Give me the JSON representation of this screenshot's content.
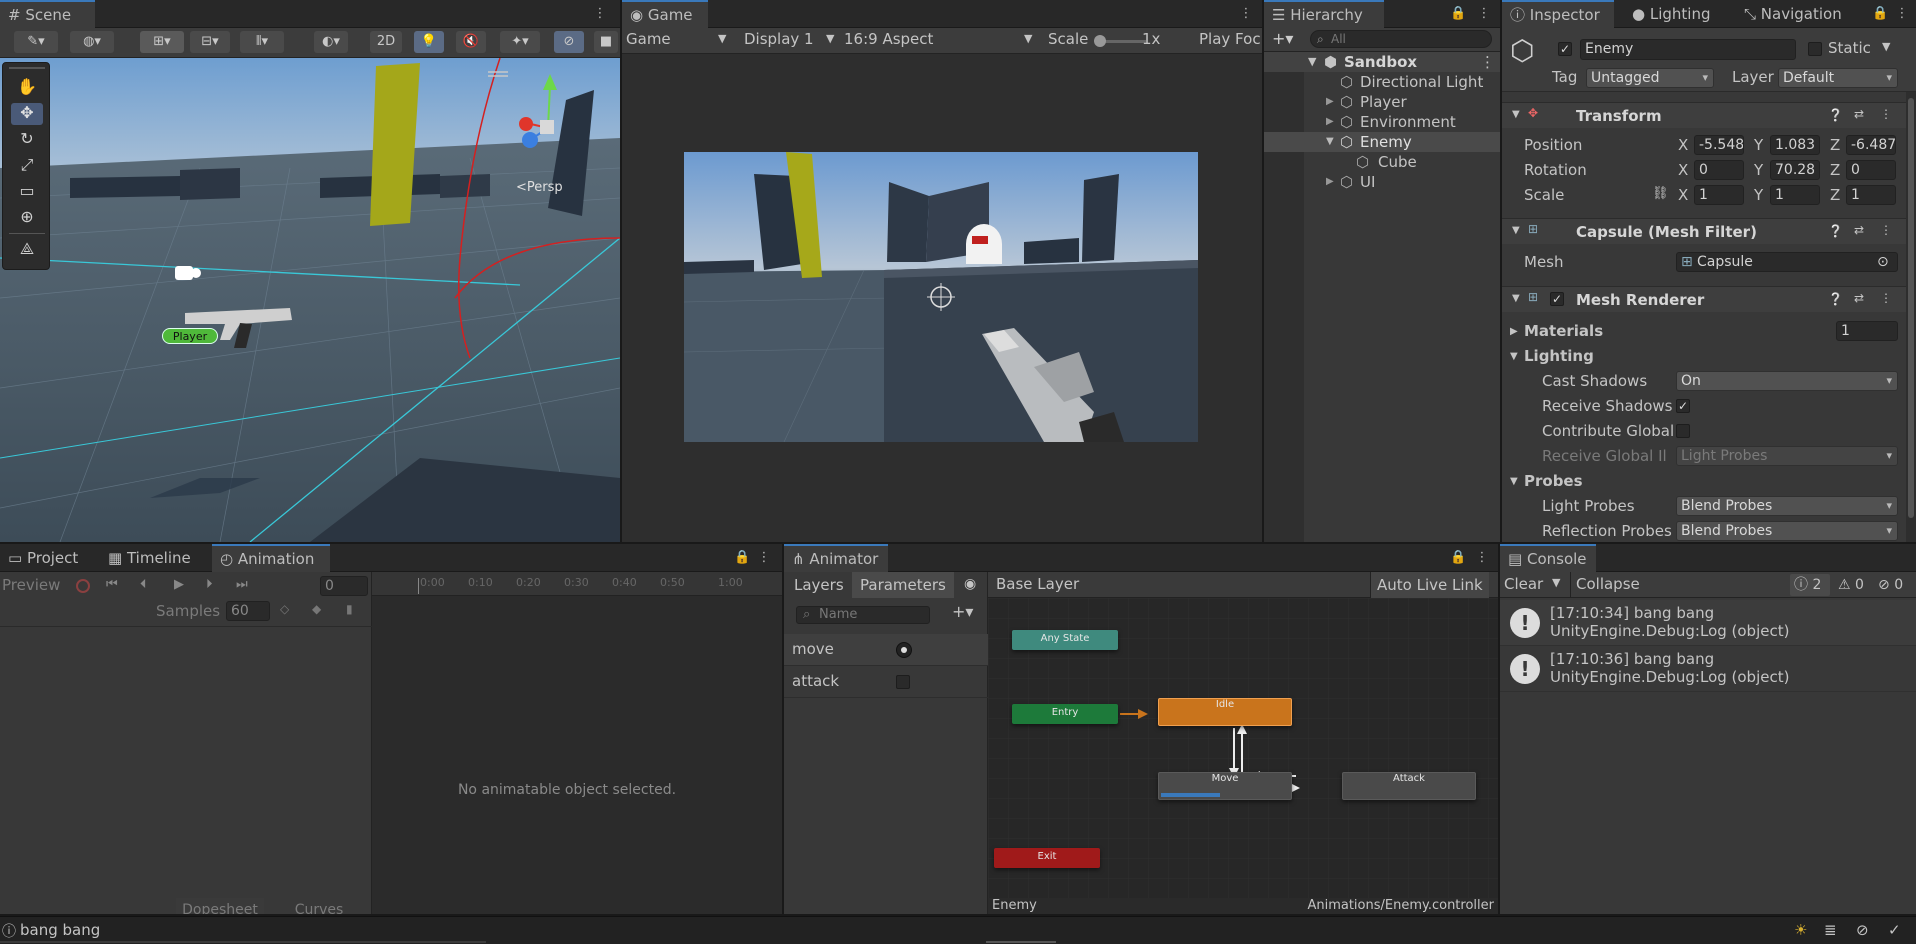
{
  "scene": {
    "tab": "Scene",
    "mode_2d": "2D",
    "persp": "Persp",
    "player_label": "Player"
  },
  "game": {
    "tab": "Game",
    "view": "Game",
    "display": "Display 1",
    "aspect": "16:9 Aspect",
    "scale_label": "Scale",
    "scale_value": "1x",
    "play_focused": "Play Foc"
  },
  "hierarchy": {
    "tab": "Hierarchy",
    "search_placeholder": "All",
    "scene_name": "Sandbox",
    "items": [
      "Directional Light",
      "Player",
      "Environment",
      "Enemy",
      "Cube",
      "UI"
    ]
  },
  "inspector": {
    "tabs": [
      "Inspector",
      "Lighting",
      "Navigation"
    ],
    "object_name": "Enemy",
    "static_label": "Static",
    "tag_label": "Tag",
    "tag_value": "Untagged",
    "layer_label": "Layer",
    "layer_value": "Default",
    "transform": {
      "title": "Transform",
      "position_label": "Position",
      "rotation_label": "Rotation",
      "scale_label": "Scale",
      "position": {
        "x": "-5.548",
        "y": "1.083",
        "z": "-6.487"
      },
      "rotation": {
        "x": "0",
        "y": "70.28",
        "z": "0"
      },
      "scale": {
        "x": "1",
        "y": "1",
        "z": "1"
      },
      "axis_x": "X",
      "axis_y": "Y",
      "axis_z": "Z"
    },
    "mesh_filter": {
      "title": "Capsule (Mesh Filter)",
      "mesh_label": "Mesh",
      "mesh_value": "Capsule"
    },
    "mesh_renderer": {
      "title": "Mesh Renderer",
      "materials_label": "Materials",
      "materials_count": "1",
      "lighting_label": "Lighting",
      "cast_shadows_label": "Cast Shadows",
      "cast_shadows_value": "On",
      "receive_shadows_label": "Receive Shadows",
      "contribute_gi_label": "Contribute Global",
      "receive_gi_label": "Receive Global Illu",
      "receive_gi_value": "Light Probes",
      "probes_label": "Probes",
      "light_probes_label": "Light Probes",
      "light_probes_value": "Blend Probes",
      "reflection_probes_label": "Reflection Probes",
      "reflection_probes_value": "Blend Probes"
    }
  },
  "animation": {
    "tabs": [
      "Project",
      "Timeline",
      "Animation"
    ],
    "preview": "Preview",
    "frame": "0",
    "samples_label": "Samples",
    "samples_value": "60",
    "ticks": [
      "0:00",
      "0:10",
      "0:20",
      "0:30",
      "0:40",
      "0:50",
      "1:00"
    ],
    "empty_message": "No animatable object selected.",
    "dopesheet": "Dopesheet",
    "curves": "Curves"
  },
  "animator": {
    "tab": "Animator",
    "layers_tab": "Layers",
    "parameters_tab": "Parameters",
    "search_placeholder": "Name",
    "base_layer": "Base Layer",
    "auto_live_link": "Auto Live Link",
    "parameters": [
      {
        "name": "move"
      },
      {
        "name": "attack"
      }
    ],
    "states": {
      "any": "Any State",
      "entry": "Entry",
      "idle": "Idle",
      "move": "Move",
      "attack": "Attack",
      "exit": "Exit"
    },
    "footer_object": "Enemy",
    "footer_controller": "Animations/Enemy.controller",
    "move_progress": 0.45
  },
  "console": {
    "tab": "Console",
    "clear": "Clear",
    "collapse": "Collapse",
    "count_info": "2",
    "count_warn": "0",
    "count_error": "0",
    "entries": [
      {
        "line1": "[17:10:34] bang bang",
        "line2": "UnityEngine.Debug:Log (object)"
      },
      {
        "line1": "[17:10:36] bang bang",
        "line2": "UnityEngine.Debug:Log (object)"
      }
    ]
  },
  "status_bar": {
    "message": "bang bang"
  },
  "colors": {
    "accent": "#3a79bb",
    "idle_state": "#c9741c",
    "entry_state": "#1d7a3a",
    "any_state": "#3f8a7e",
    "exit_state": "#a01a1a",
    "player_badge": "#4fb83a"
  }
}
